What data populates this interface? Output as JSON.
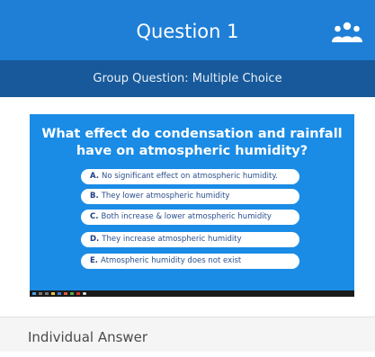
{
  "header": {
    "title": "Question 1",
    "icon": "group-icon",
    "background": "#1f7fd6"
  },
  "subheader": {
    "text": "Group Question: Multiple Choice",
    "background": "#17599a"
  },
  "slide": {
    "question": "What effect do condensation and rainfall have on atmospheric humidity?",
    "background": "#1a8ce6",
    "options": [
      {
        "letter": "A.",
        "text": "No significant effect on atmospheric humidity."
      },
      {
        "letter": "B.",
        "text": "They lower atmospheric humidity"
      },
      {
        "letter": "C.",
        "text": "Both increase & lower atmospheric humidity"
      },
      {
        "letter": "D.",
        "text": "They increase atmospheric humidity"
      },
      {
        "letter": "E.",
        "text": "Atmospheric humidity does not exist"
      }
    ]
  },
  "section": {
    "label": "Individual Answer"
  }
}
